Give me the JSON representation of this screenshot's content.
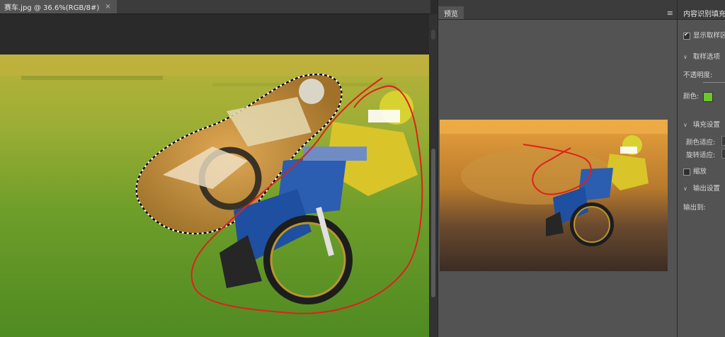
{
  "document": {
    "tab_title": "赛车.jpg @ 36.6%(RGB/8#)",
    "close_glyph": "×",
    "image_alt": "speedway riders"
  },
  "preview": {
    "tab_label": "预览",
    "menu_glyph": "≡"
  },
  "settings": {
    "title": "内容识别填充",
    "show_sampling_label": "显示取样区",
    "show_sampling_checked": true,
    "sampling_section": "取样选项",
    "opacity_label": "不透明度:",
    "color_label": "颜色:",
    "color_value": "#6cc62a",
    "fill_section": "填充设置",
    "color_adapt_label": "颜色适应:",
    "rotate_adapt_label": "旋转适应:",
    "scale_label": "缩放",
    "scale_checked": false,
    "output_section": "输出设置",
    "output_to_label": "输出到:"
  }
}
